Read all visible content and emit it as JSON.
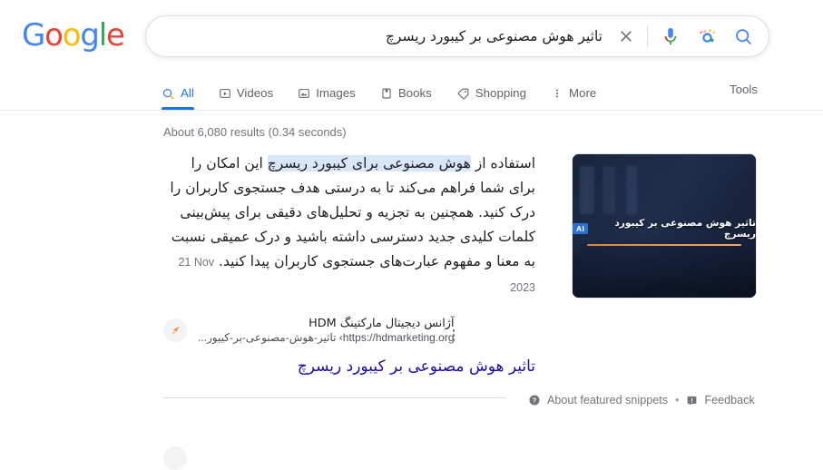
{
  "brand": {
    "logo_text": "Google",
    "logo_letters": [
      {
        "ch": "G",
        "color": "#4285f4"
      },
      {
        "ch": "o",
        "color": "#ea4335"
      },
      {
        "ch": "o",
        "color": "#fbbc05"
      },
      {
        "ch": "g",
        "color": "#4285f4"
      },
      {
        "ch": "l",
        "color": "#34a853"
      },
      {
        "ch": "e",
        "color": "#ea4335"
      }
    ]
  },
  "search": {
    "query": "تاثیر هوش مصنوعی بر کیبورد ریسرچ",
    "placeholder": "Search",
    "clear_icon": "close-icon",
    "mic_icon": "microphone-icon",
    "lens_icon": "google-lens-icon",
    "search_icon": "search-icon"
  },
  "nav": {
    "tabs": [
      {
        "label": "All",
        "icon": "magnifier-icon",
        "active": true
      },
      {
        "label": "Videos",
        "icon": "video-icon",
        "active": false
      },
      {
        "label": "Images",
        "icon": "image-icon",
        "active": false
      },
      {
        "label": "Books",
        "icon": "book-icon",
        "active": false
      },
      {
        "label": "Shopping",
        "icon": "tag-icon",
        "active": false
      },
      {
        "label": "More",
        "icon": "more-vertical-icon",
        "active": false
      }
    ],
    "tools_label": "Tools"
  },
  "results": {
    "stats": "About 6,080 results (0.34 seconds)",
    "featured_snippet": {
      "text_before": "استفاده از ",
      "text_highlight": "هوش مصنوعی برای کیبورد ریسرچ",
      "text_after": " این امکان را برای شما فراهم می‌کند تا به درستی هدف جستجوی کاربران را درک کنید. همچنین به تجزیه و تحلیل‌های دقیقی برای پیش‌بینی کلمات کلیدی جدید دسترسی داشته باشید و درک عمیقی نسبت به معنا و مفهوم عبارت‌های جستجوی کاربران پیدا کنید.",
      "date": "21 Nov 2023",
      "thumbnail": {
        "title": "تاثیر هوش مصنوعی بر کیبورد ریسرچ",
        "badge": "AI",
        "accent_color": "#e0833c",
        "bg_color": "#1b2741"
      },
      "source": {
        "name": "آژانس دیجیتال مارکتینگ HDM",
        "url_domain": "https://hdmarketing.org",
        "url_breadcrumb": "› تاثیر-هوش-مصنوعی-بر-کیبور... ",
        "favicon_icon": "rocket-arrow-icon",
        "menu_icon": "kebab-menu-icon"
      },
      "title_link": "تاثیر هوش مصنوعی بر کیبورد ریسرچ",
      "footer": {
        "about_icon": "question-circle-icon",
        "about_label": "About featured snippets",
        "separator": "•",
        "feedback_icon": "feedback-icon",
        "feedback_label": "Feedback"
      }
    }
  },
  "colors": {
    "link_blue": "#1a0dab",
    "tab_active": "#1a73e8",
    "highlight": "#d8e6f8",
    "muted_text": "#70757a"
  }
}
